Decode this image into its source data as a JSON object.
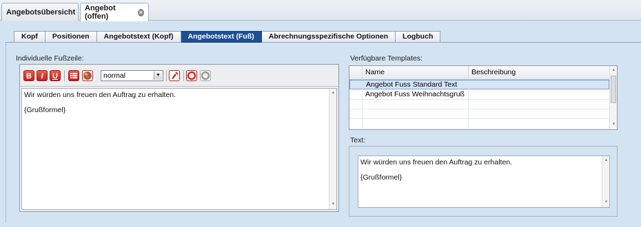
{
  "doc_tabs": [
    {
      "label": "Angebotsübersicht",
      "close": "⊗"
    },
    {
      "label": "Angebot (offen)",
      "close": "⊗"
    }
  ],
  "sub_tabs": [
    "Kopf",
    "Positionen",
    "Angebotstext (Kopf)",
    "Angebotstext (Fuß)",
    "Abrechnungsspezifische Optionen",
    "Logbuch"
  ],
  "active_sub_tab": "Angebotstext (Fuß)",
  "left": {
    "label": "Individuelle Fußzeile:",
    "toolbar": {
      "bold": "B",
      "italic": "I",
      "underline": "U",
      "format_value": "normal"
    },
    "lines": [
      "Wir würden uns freuen den Auftrag zu erhalten.",
      "{Grußformel}"
    ]
  },
  "right": {
    "templates_label": "Verfügbare Templates:",
    "columns": [
      "Name",
      "Beschreibung"
    ],
    "rows": [
      {
        "name": "Angebot Fuss Standard Text",
        "desc": ""
      },
      {
        "name": "Angebot Fuss Weihnachtsgruß",
        "desc": ""
      }
    ],
    "text_label": "Text:",
    "lines": [
      "Wir würden uns freuen den Auftrag zu erhalten.",
      "{Grußformel}"
    ]
  },
  "colors": {
    "active_tab": "#1d4f93",
    "accent_red": "#d42f22",
    "selection": "#d6e4f6"
  }
}
